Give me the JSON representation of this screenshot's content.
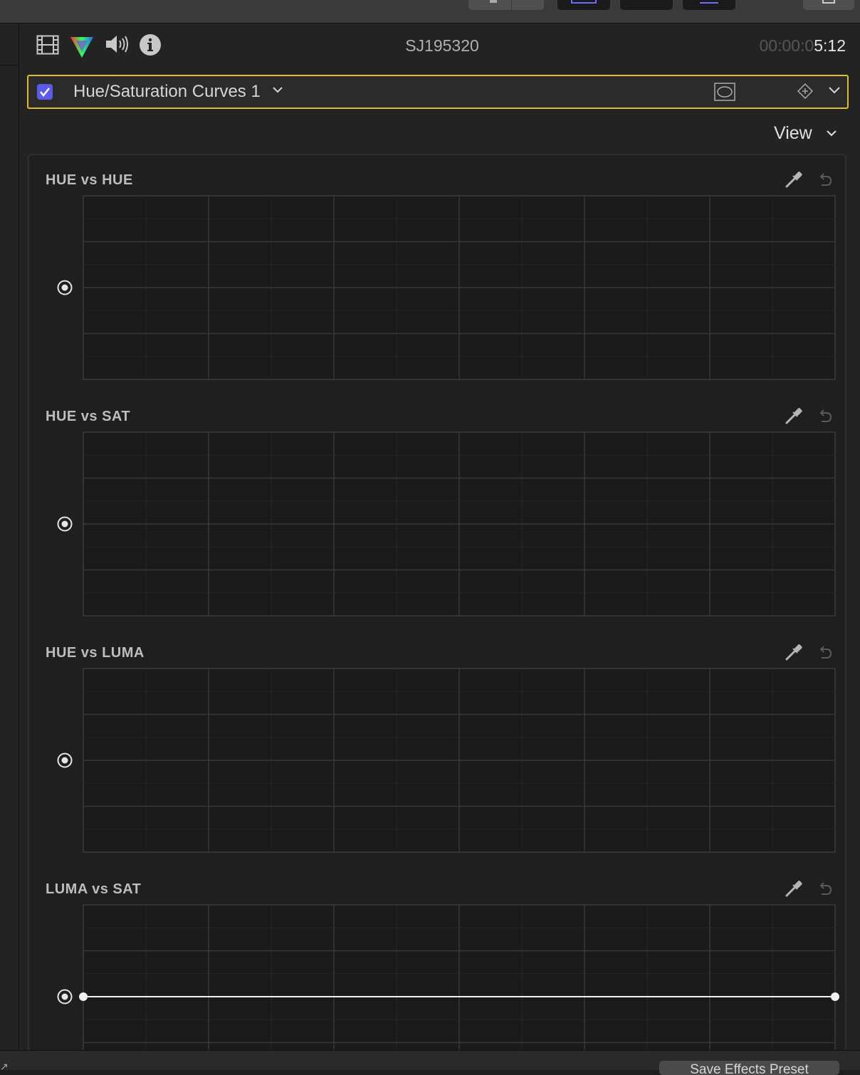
{
  "toolbar": {
    "accent_color": "#6b6bff"
  },
  "inspector": {
    "clip_name": "SJ195320",
    "timecode_dim": "00:00:0",
    "timecode_bright": "5:12",
    "icons": [
      "film-icon",
      "color-board-icon",
      "audio-icon",
      "info-icon"
    ]
  },
  "effect": {
    "enabled": true,
    "title": "Hue/Saturation Curves 1",
    "border_color": "#d9bf2f",
    "checkbox_color": "#5b5be6"
  },
  "view_menu": {
    "label": "View"
  },
  "curves": [
    {
      "title": "HUE vs HUE",
      "curve_type": "hue-spectrum"
    },
    {
      "title": "HUE vs SAT",
      "curve_type": "hue-spectrum"
    },
    {
      "title": "HUE vs LUMA",
      "curve_type": "hue-spectrum"
    },
    {
      "title": "LUMA vs SAT",
      "curve_type": "white-with-endpoints"
    }
  ],
  "footer": {
    "save_preset_label": "Save Effects Preset"
  }
}
